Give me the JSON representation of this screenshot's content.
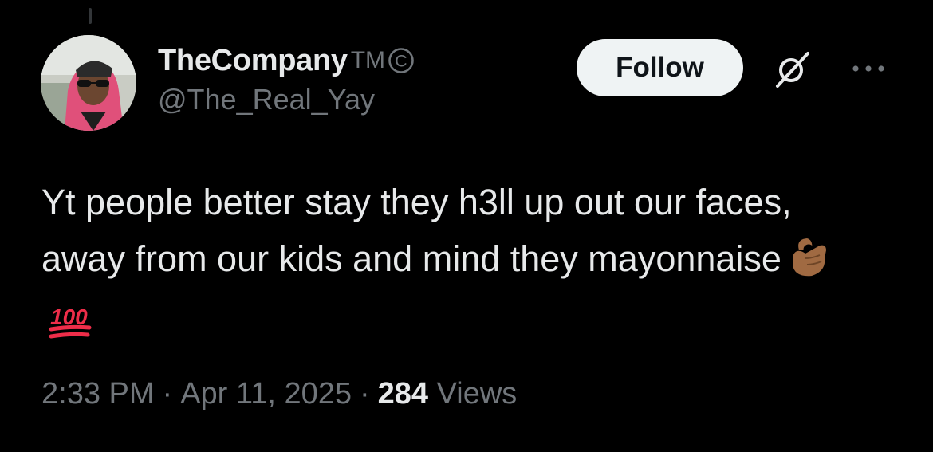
{
  "tweet": {
    "author": {
      "display_name": "TheCompany",
      "badge_tm": "TM",
      "badge_copyright": "C",
      "handle": "@The_Real_Yay",
      "avatar": "profile-photo"
    },
    "follow_label": "Follow",
    "text": "Yt people better stay they h3ll up out our faces, away from our kids and mind they mayonnaise",
    "emojis": [
      "ok-hand-emoji",
      "hundred-points-emoji"
    ],
    "time": "2:33 PM",
    "separator": "·",
    "date": "Apr 11, 2025",
    "views_count": "284",
    "views_label": "Views"
  },
  "icons": {
    "grok": "grok-icon",
    "more": "more-icon"
  },
  "colors": {
    "background": "#000000",
    "primary_text": "#e7e9ea",
    "secondary_text": "#71767b",
    "follow_bg": "#eff3f4"
  }
}
